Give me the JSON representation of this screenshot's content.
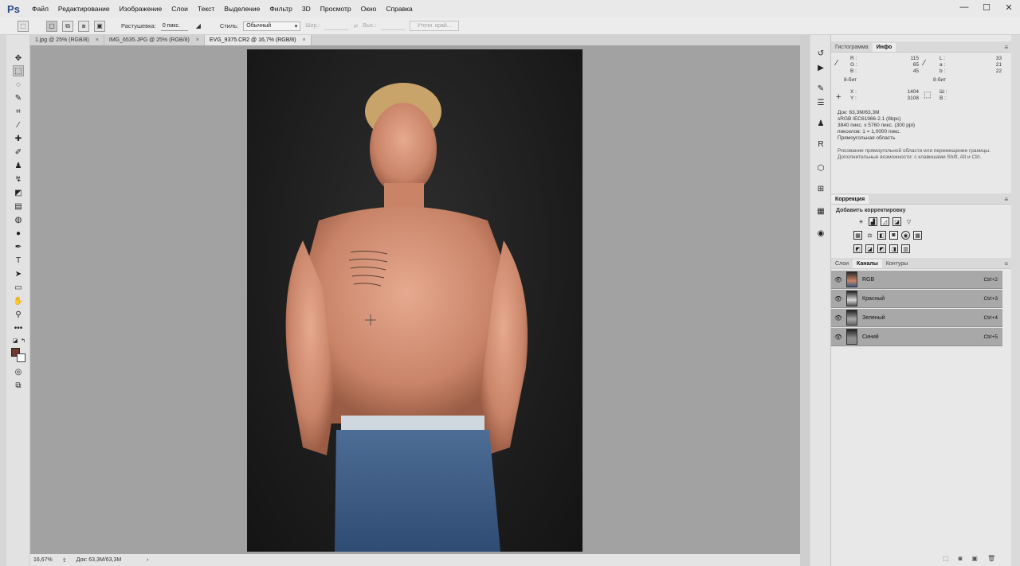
{
  "app": {
    "logo": "Ps"
  },
  "menu": [
    "Файл",
    "Редактирование",
    "Изображение",
    "Слои",
    "Текст",
    "Выделение",
    "Фильтр",
    "3D",
    "Просмотр",
    "Окно",
    "Справка"
  ],
  "window_controls": [
    "—",
    "☐",
    "✕"
  ],
  "options": {
    "feather_label": "Растушевка:",
    "feather_value": "0 пикс.",
    "style_label": "Стиль:",
    "style_value": "Обычный",
    "width_label": "Шир.:",
    "height_label": "Выс.:",
    "refine_label": "Уточн. край..."
  },
  "tabs": [
    {
      "label": "1.jpg @ 25% (RGB/8)",
      "close": "×"
    },
    {
      "label": "IMG_6535.JPG @ 25% (RGB/8)",
      "close": "×"
    },
    {
      "label": "EVG_9375.CR2 @ 16,7% (RGB/8)",
      "close": "×"
    }
  ],
  "status": {
    "zoom": "16,67%",
    "doc": "Док: 63,3M/63,3M",
    "arrow": "›"
  },
  "info": {
    "tabs": [
      "Гистограмма",
      "Инфо"
    ],
    "rgb": {
      "R": "R :",
      "G": "G :",
      "B": "B :",
      "r_val": "115",
      "g_val": "65",
      "b_val": "45",
      "depth": "8-бит"
    },
    "lab": {
      "L": "L :",
      "a": "a :",
      "b": "b :",
      "l_val": "33",
      "a_val": "21",
      "b_val": "22",
      "depth": "8-бит"
    },
    "xy": {
      "X": "X :",
      "Y": "Y :",
      "x_val": "1404",
      "y_val": "3108"
    },
    "wh": {
      "W": "Ш :",
      "H": "В :"
    },
    "doc_lines": [
      "Док: 63,3M/63,3M",
      "sRGB IEC61966-2.1 (8bpc)",
      "3840 пикс. x 5760 пикс. (300 ppi)",
      "пикселов: 1 = 1,0000 пикс.",
      "Прямоугольная область"
    ],
    "hint_lines": [
      "Рисование прямоугольной области или перемещение границы.",
      "Дополнительные возможности: с клавишами Shift, Alt и Ctrl."
    ]
  },
  "correction": {
    "title": "Коррекция",
    "subtitle": "Добавить корректировку"
  },
  "channels": {
    "tabs": [
      "Слои",
      "Каналы",
      "Контуры"
    ],
    "rows": [
      {
        "name": "RGB",
        "shortcut": "Ctrl+2"
      },
      {
        "name": "Красный",
        "shortcut": "Ctrl+3"
      },
      {
        "name": "Зеленый",
        "shortcut": "Ctrl+4"
      },
      {
        "name": "Синий",
        "shortcut": "Ctrl+5"
      }
    ]
  }
}
